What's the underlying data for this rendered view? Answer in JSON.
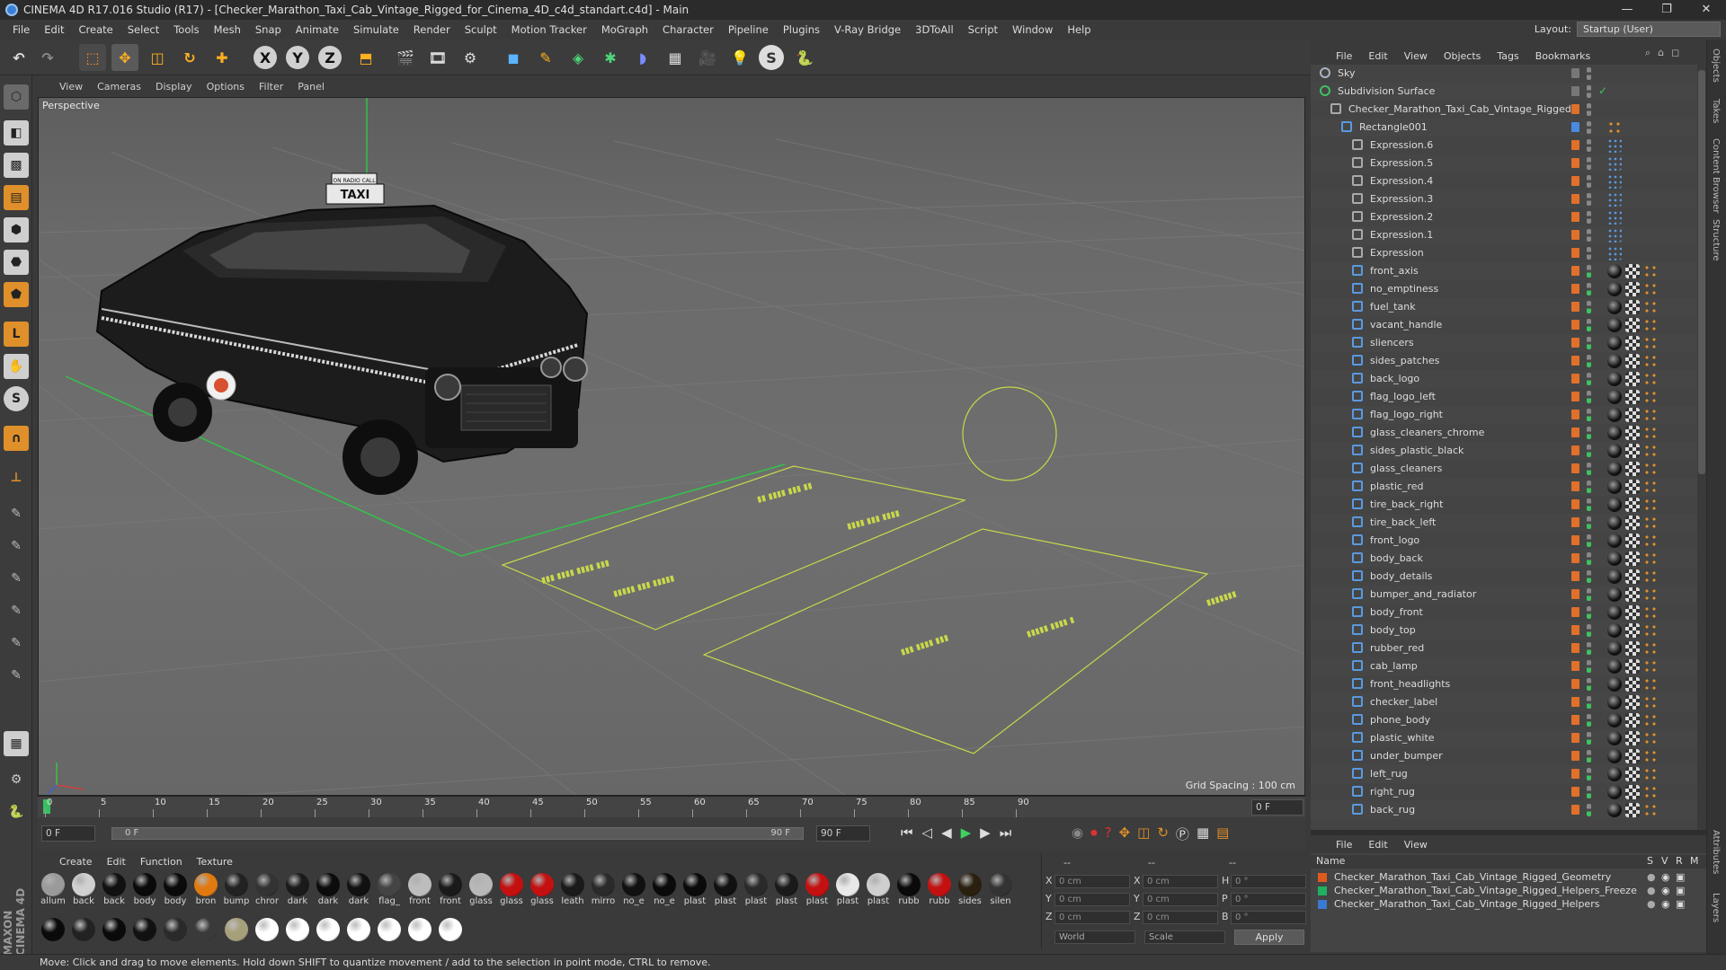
{
  "window": {
    "title": "CINEMA 4D R17.016 Studio (R17) - [Checker_Marathon_Taxi_Cab_Vintage_Rigged_for_Cinema_4D_c4d_standart.c4d] - Main",
    "controls": [
      "—",
      "❐",
      "✕"
    ]
  },
  "menubar": [
    "File",
    "Edit",
    "Create",
    "Select",
    "Tools",
    "Mesh",
    "Snap",
    "Animate",
    "Simulate",
    "Render",
    "Sculpt",
    "Motion Tracker",
    "MoGraph",
    "Character",
    "Pipeline",
    "Plugins",
    "V-Ray Bridge",
    "3DToAll",
    "Script",
    "Window",
    "Help"
  ],
  "layout": {
    "label": "Layout:",
    "value": "Startup (User)"
  },
  "viewport": {
    "menu": [
      "View",
      "Cameras",
      "Display",
      "Options",
      "Filter",
      "Panel"
    ],
    "label": "Perspective",
    "grid_spacing": "Grid Spacing : 100 cm",
    "taxi_sign": "TAXI",
    "radio_sign": "ON RADIO CALL"
  },
  "timeline": {
    "ticks": [
      "0",
      "5",
      "10",
      "15",
      "20",
      "25",
      "30",
      "35",
      "40",
      "45",
      "50",
      "55",
      "60",
      "65",
      "70",
      "75",
      "80",
      "85",
      "90"
    ],
    "current_frame_right": "0 F",
    "start": "0 F",
    "range_start": "0 F",
    "range_end": "90 F",
    "end": "90 F"
  },
  "materials": {
    "menu": [
      "Create",
      "Edit",
      "Function",
      "Texture"
    ],
    "row1": [
      {
        "name": "allum",
        "color": "#9a9a9a"
      },
      {
        "name": "back",
        "color": "#d0d0d0"
      },
      {
        "name": "back",
        "color": "#111111"
      },
      {
        "name": "body",
        "color": "#0a0a0a"
      },
      {
        "name": "body",
        "color": "#0a0a0a"
      },
      {
        "name": "bron",
        "color": "#e07a10"
      },
      {
        "name": "bump",
        "color": "#222222"
      },
      {
        "name": "chror",
        "color": "#333333"
      },
      {
        "name": "dark",
        "color": "#1a1a1a"
      },
      {
        "name": "dark",
        "color": "#0c0c0c"
      },
      {
        "name": "dark",
        "color": "#111111"
      },
      {
        "name": "flag_",
        "color": "#444444"
      },
      {
        "name": "front",
        "color": "#bdbdbd"
      },
      {
        "name": "front",
        "color": "#1a1a1a"
      },
      {
        "name": "glass",
        "color": "#b8b8b8"
      },
      {
        "name": "glass",
        "color": "#c41010"
      },
      {
        "name": "glass",
        "color": "#c41010"
      },
      {
        "name": "leath",
        "color": "#1a1a1a"
      },
      {
        "name": "mirro",
        "color": "#2a2a2a"
      },
      {
        "name": "no_e",
        "color": "#111111"
      },
      {
        "name": "no_e",
        "color": "#0a0a0a"
      },
      {
        "name": "plast",
        "color": "#0a0a0a"
      },
      {
        "name": "plast",
        "color": "#111111"
      },
      {
        "name": "plast",
        "color": "#2a2a2a"
      },
      {
        "name": "plast",
        "color": "#1a1a1a"
      },
      {
        "name": "plast",
        "color": "#c41010"
      },
      {
        "name": "plast",
        "color": "#e8e8e8"
      },
      {
        "name": "plast",
        "color": "#cfcfcf"
      },
      {
        "name": "rubb",
        "color": "#0a0a0a"
      },
      {
        "name": "rubb",
        "color": "#c41010"
      },
      {
        "name": "sides",
        "color": "#2a2010"
      },
      {
        "name": "silen",
        "color": "#333333"
      }
    ],
    "row2": [
      "#0a0a0a",
      "#222222",
      "#0a0a0a",
      "#111111",
      "#2a2a2a",
      "#3a3a3a",
      "#a6a07a",
      "#ffffff",
      "#ffffff",
      "#ffffff",
      "#ffffff",
      "#ffffff",
      "#ffffff",
      "#ffffff"
    ]
  },
  "coords": {
    "header": [
      "--",
      "--",
      "--"
    ],
    "rows": [
      {
        "a": "X",
        "av": "0 cm",
        "b": "X",
        "bv": "0 cm",
        "c": "H",
        "cv": "0 °"
      },
      {
        "a": "Y",
        "av": "0 cm",
        "b": "Y",
        "bv": "0 cm",
        "c": "P",
        "cv": "0 °"
      },
      {
        "a": "Z",
        "av": "0 cm",
        "b": "Z",
        "bv": "0 cm",
        "c": "B",
        "cv": "0 °"
      }
    ],
    "mode": "World",
    "size_mode": "Scale",
    "apply": "Apply"
  },
  "status": "Move: Click and drag to move elements. Hold down SHIFT to quantize movement / add to the selection in point mode, CTRL to remove.",
  "objects": {
    "menu": [
      "File",
      "Edit",
      "View",
      "Objects",
      "Tags",
      "Bookmarks"
    ],
    "rows": [
      {
        "name": "Sky",
        "indent": 0,
        "type": "sky"
      },
      {
        "name": "Subdivision Surface",
        "indent": 0,
        "type": "subd"
      },
      {
        "name": "Checker_Marathon_Taxi_Cab_Vintage_Rigged",
        "indent": 1,
        "type": "null"
      },
      {
        "name": "Rectangle001",
        "indent": 2,
        "type": "spline"
      },
      {
        "name": "Expression.6",
        "indent": 3,
        "type": "null"
      },
      {
        "name": "Expression.5",
        "indent": 3,
        "type": "null"
      },
      {
        "name": "Expression.4",
        "indent": 3,
        "type": "null"
      },
      {
        "name": "Expression.3",
        "indent": 3,
        "type": "null"
      },
      {
        "name": "Expression.2",
        "indent": 3,
        "type": "null"
      },
      {
        "name": "Expression.1",
        "indent": 3,
        "type": "null"
      },
      {
        "name": "Expression",
        "indent": 3,
        "type": "null"
      },
      {
        "name": "front_axis",
        "indent": 3,
        "type": "poly"
      },
      {
        "name": "no_emptiness",
        "indent": 3,
        "type": "poly"
      },
      {
        "name": "fuel_tank",
        "indent": 3,
        "type": "poly"
      },
      {
        "name": "vacant_handle",
        "indent": 3,
        "type": "poly"
      },
      {
        "name": "sliencers",
        "indent": 3,
        "type": "poly"
      },
      {
        "name": "sides_patches",
        "indent": 3,
        "type": "poly"
      },
      {
        "name": "back_logo",
        "indent": 3,
        "type": "poly"
      },
      {
        "name": "flag_logo_left",
        "indent": 3,
        "type": "poly"
      },
      {
        "name": "flag_logo_right",
        "indent": 3,
        "type": "poly"
      },
      {
        "name": "glass_cleaners_chrome",
        "indent": 3,
        "type": "poly"
      },
      {
        "name": "sides_plastic_black",
        "indent": 3,
        "type": "poly"
      },
      {
        "name": "glass_cleaners",
        "indent": 3,
        "type": "poly"
      },
      {
        "name": "plastic_red",
        "indent": 3,
        "type": "poly"
      },
      {
        "name": "tire_back_right",
        "indent": 3,
        "type": "poly"
      },
      {
        "name": "tire_back_left",
        "indent": 3,
        "type": "poly"
      },
      {
        "name": "front_logo",
        "indent": 3,
        "type": "poly"
      },
      {
        "name": "body_back",
        "indent": 3,
        "type": "poly"
      },
      {
        "name": "body_details",
        "indent": 3,
        "type": "poly"
      },
      {
        "name": "bumper_and_radiator",
        "indent": 3,
        "type": "poly"
      },
      {
        "name": "body_front",
        "indent": 3,
        "type": "poly"
      },
      {
        "name": "body_top",
        "indent": 3,
        "type": "poly"
      },
      {
        "name": "rubber_red",
        "indent": 3,
        "type": "poly"
      },
      {
        "name": "cab_lamp",
        "indent": 3,
        "type": "poly"
      },
      {
        "name": "front_headlights",
        "indent": 3,
        "type": "poly"
      },
      {
        "name": "checker_label",
        "indent": 3,
        "type": "poly"
      },
      {
        "name": "phone_body",
        "indent": 3,
        "type": "poly"
      },
      {
        "name": "plastic_white",
        "indent": 3,
        "type": "poly"
      },
      {
        "name": "under_bumper",
        "indent": 3,
        "type": "poly"
      },
      {
        "name": "left_rug",
        "indent": 3,
        "type": "poly"
      },
      {
        "name": "right_rug",
        "indent": 3,
        "type": "poly"
      },
      {
        "name": "back_rug",
        "indent": 3,
        "type": "poly"
      }
    ]
  },
  "layers": {
    "menu": [
      "File",
      "Edit",
      "View"
    ],
    "header": {
      "name": "Name",
      "cols": [
        "S",
        "V",
        "R",
        "M"
      ]
    },
    "rows": [
      {
        "name": "Checker_Marathon_Taxi_Cab_Vintage_Rigged_Geometry",
        "color": "#e05a20"
      },
      {
        "name": "Checker_Marathon_Taxi_Cab_Vintage_Rigged_Helpers_Freeze",
        "color": "#20b060"
      },
      {
        "name": "Checker_Marathon_Taxi_Cab_Vintage_Rigged_Helpers",
        "color": "#3a7ad0"
      }
    ]
  },
  "side_tabs": [
    "Objects",
    "Takes",
    "Content Browser",
    "Structure",
    "Attributes",
    "Layers"
  ]
}
